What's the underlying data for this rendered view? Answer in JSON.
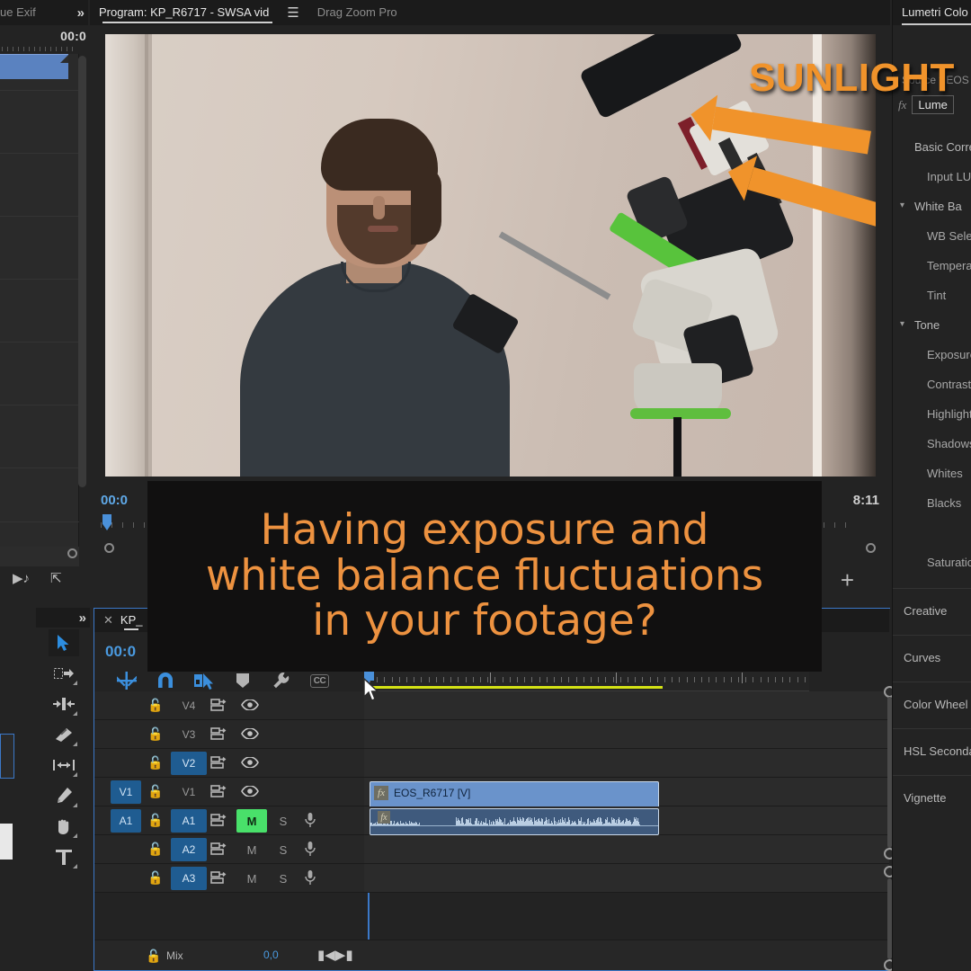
{
  "left_panel": {
    "tab_label": "ue Exif",
    "expand_icon": "chevron-double-right-icon",
    "timecode": "00:0",
    "footer_icons": [
      "play-audio-icon",
      "export-frame-icon"
    ]
  },
  "program_monitor": {
    "tab_label": "Program: KP_R6717 - SWSA vid",
    "menu_icon": "hamburger-menu-icon",
    "second_tab": "Drag Zoom Pro",
    "timecode_left": "00:0",
    "timecode_right": "8:11",
    "button_editor": "+",
    "overlay_title": "SUNLIGHT",
    "arrows": [
      "sunlight-arrow-1",
      "sunlight-arrow-2"
    ]
  },
  "caption": {
    "line1": "Having exposure and",
    "line2": "white balance fluctuations",
    "line3": "in your footage?",
    "text_color": "#ed9240",
    "background": "#111010"
  },
  "tools": {
    "items": [
      {
        "name": "selection-tool",
        "glyph": "arrow",
        "selected": true
      },
      {
        "name": "track-select-forward-tool",
        "glyph": "track-select",
        "selected": false
      },
      {
        "name": "ripple-edit-tool",
        "glyph": "ripple",
        "selected": false
      },
      {
        "name": "razor-tool",
        "glyph": "razor",
        "selected": false
      },
      {
        "name": "slip-tool",
        "glyph": "slip",
        "selected": false
      },
      {
        "name": "pen-tool",
        "glyph": "pen",
        "selected": false
      },
      {
        "name": "hand-tool",
        "glyph": "hand",
        "selected": false
      },
      {
        "name": "type-tool",
        "glyph": "type",
        "selected": false
      }
    ]
  },
  "timeline": {
    "tab_label": "KP_",
    "close_icon": "close-icon",
    "timecode": "00:0",
    "toolbar_icons": [
      "nested-sequence-icon",
      "snap-magnet-icon",
      "linked-selection-icon",
      "add-marker-icon",
      "timeline-settings-wrench-icon",
      "closed-captions-icon"
    ],
    "cc_label": "CC",
    "render_bar_color": "#d4e215",
    "playhead_color": "#4a90d9",
    "tracks": [
      {
        "name": "V4",
        "target": "",
        "targeted": false,
        "sync": "sync-lock-icon",
        "eye": "eye-icon",
        "type": "video"
      },
      {
        "name": "V3",
        "target": "",
        "targeted": false,
        "sync": "sync-lock-icon",
        "eye": "eye-icon",
        "type": "video"
      },
      {
        "name": "V2",
        "target": "",
        "targeted": true,
        "sync": "sync-lock-icon",
        "eye": "eye-icon",
        "type": "video"
      },
      {
        "name": "V1",
        "target": "V1",
        "targeted": false,
        "sync": "sync-lock-icon",
        "eye": "eye-icon",
        "type": "video"
      },
      {
        "name": "A1",
        "target": "A1",
        "targeted": true,
        "sync": "sync-lock-icon",
        "mute": "M",
        "solo": "S",
        "mic": "mic-icon",
        "muted": true,
        "type": "audio"
      },
      {
        "name": "A2",
        "target": "",
        "targeted": true,
        "sync": "sync-lock-icon",
        "mute": "M",
        "solo": "S",
        "mic": "mic-icon",
        "muted": false,
        "type": "audio"
      },
      {
        "name": "A3",
        "target": "",
        "targeted": true,
        "sync": "sync-lock-icon",
        "mute": "M",
        "solo": "S",
        "mic": "mic-icon",
        "muted": false,
        "type": "audio"
      }
    ],
    "mix": {
      "label": "Mix",
      "value": "0,0",
      "lock": "lock-icon",
      "icon": "mix-meter-icon"
    },
    "clips": {
      "video": {
        "label": "EOS_R6717 [V]",
        "fx_badge": "fx",
        "color": "#6a93cb"
      },
      "audio": {
        "label": "",
        "fx_badge": "fx",
        "color": "#3f5a7d"
      }
    }
  },
  "lumetri": {
    "tab_label": "Lumetri Colo",
    "source_label": "Source * EOS",
    "fx_icon": "fx-icon",
    "preset_label": "Lume",
    "sections": [
      {
        "label": "Basic Correc",
        "level": 0,
        "caret": ""
      },
      {
        "label": "Input LUT",
        "level": 1,
        "caret": ""
      },
      {
        "label": "White Ba",
        "level": 0,
        "caret": "chevron-down-icon"
      },
      {
        "label": "WB Selec",
        "level": 1,
        "caret": ""
      },
      {
        "label": "Temperat",
        "level": 1,
        "caret": ""
      },
      {
        "label": "Tint",
        "level": 1,
        "caret": ""
      },
      {
        "label": "Tone",
        "level": 0,
        "caret": "chevron-down-icon"
      },
      {
        "label": "Exposure",
        "level": 1,
        "caret": ""
      },
      {
        "label": "Contrast",
        "level": 1,
        "caret": ""
      },
      {
        "label": "Highlight",
        "level": 1,
        "caret": ""
      },
      {
        "label": "Shadows",
        "level": 1,
        "caret": ""
      },
      {
        "label": "Whites",
        "level": 1,
        "caret": ""
      },
      {
        "label": "Blacks",
        "level": 1,
        "caret": ""
      },
      {
        "label": "Saturatio",
        "level": 1,
        "caret": ""
      }
    ],
    "panels": [
      "Creative",
      "Curves",
      "Color Wheel",
      "HSL Seconda",
      "Vignette"
    ]
  }
}
